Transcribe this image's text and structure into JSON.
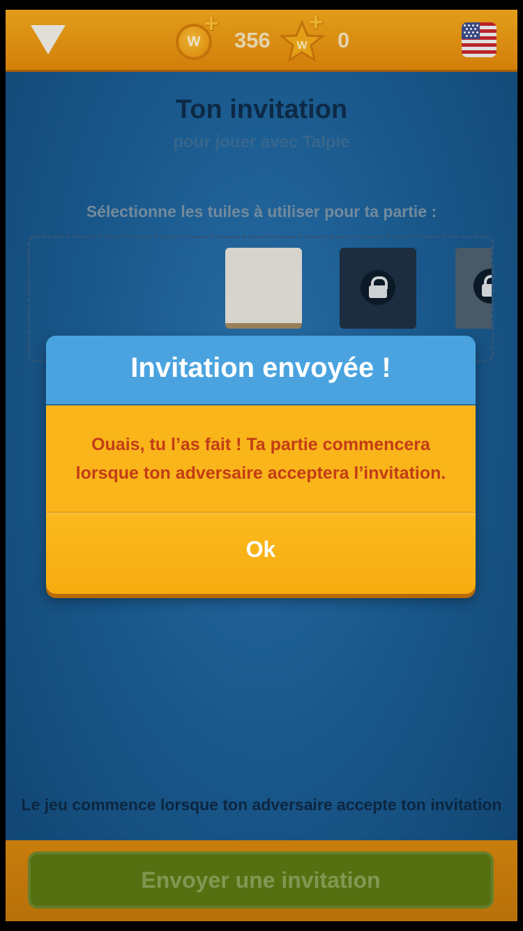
{
  "header": {
    "coins": "356",
    "stars": "0",
    "coin_letter": "W",
    "star_letter": "W",
    "menu_icon": "menu-triangle-icon",
    "flag_icon": "us-flag-icon"
  },
  "main": {
    "title": "Ton invitation",
    "subtitle": "pour jouer avec Talpie",
    "select_label": "Sélectionne les tuiles à utiliser pour ta partie :",
    "footer_note": "Le jeu commence lorsque ton adversaire accepte ton invitation",
    "send_button": "Envoyer une invitation"
  },
  "modal": {
    "title": "Invitation envoyée !",
    "message": "Ouais, tu l’as fait ! Ta partie commencera lorsque ton adversaire acceptera l’invitation.",
    "ok_label": "Ok"
  },
  "colors": {
    "topbar": "#f5ab1c",
    "modal_header": "#4aa3df",
    "modal_body": "#f9b51a",
    "message_text": "#c33c16",
    "send_button": "#5d7a13"
  }
}
